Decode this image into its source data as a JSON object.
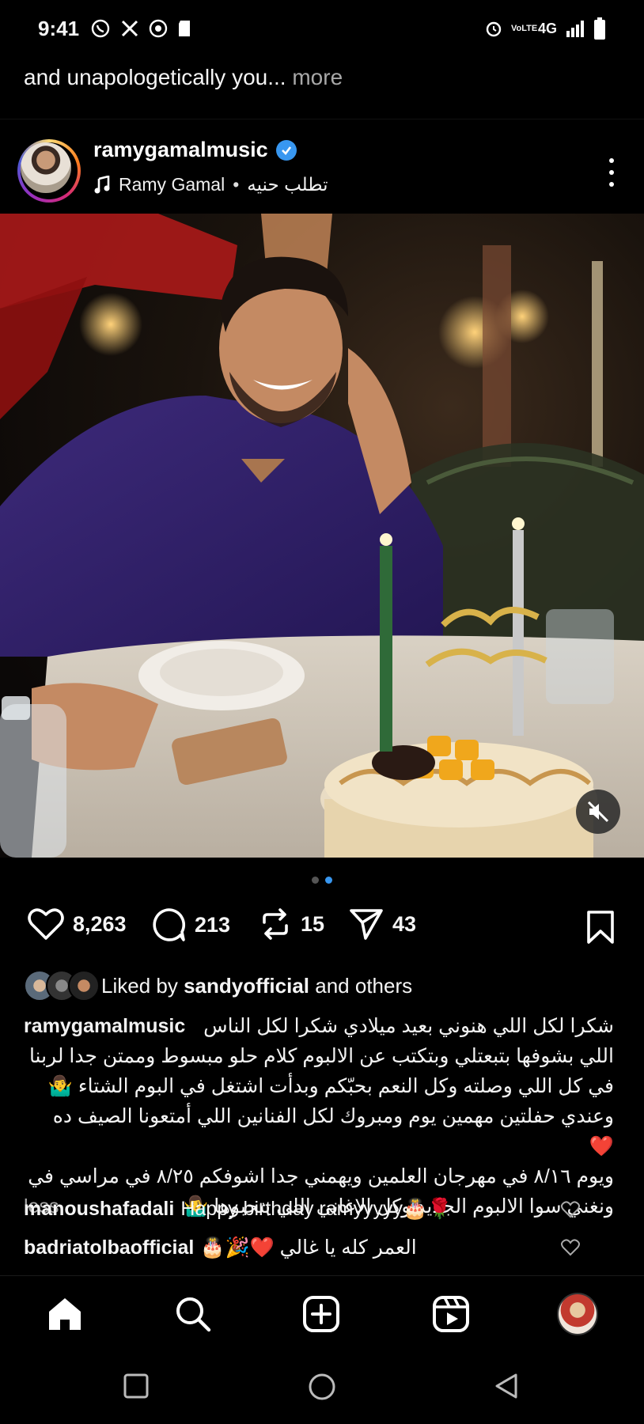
{
  "status_bar": {
    "time": "9:41",
    "left_icons": [
      "whatsapp-icon",
      "x-icon",
      "chrome-icon",
      "sd-card-icon"
    ],
    "network": "4G",
    "volte": "VoLTE"
  },
  "previous_post": {
    "caption_tail": "and unapologetically you...",
    "more_label": "more"
  },
  "post": {
    "username": "ramygamalmusic",
    "verified": true,
    "audio_artist": "Ramy Gamal",
    "audio_separator": "•",
    "audio_track": "تطلب حنيه",
    "carousel": {
      "count": 2,
      "active_index": 1
    },
    "stats": {
      "likes": "8,263",
      "comments": "213",
      "reposts": "15",
      "shares": "43"
    },
    "liked_by_prefix": "Liked by",
    "liked_by_user": "sandyofficial",
    "liked_by_suffix": "and others",
    "caption_user": "ramygamalmusic",
    "caption_lines": [
      "شكرا لكل اللي هنوني بعيد ميلادي شكرا لكل الناس",
      "اللي بشوفها بتبعتلي وبتكتب عن الالبوم كلام حلو مبسوط وممتن جدا لربنا",
      "في كل اللي وصلته وكل النعم بحبّكم وبدأت اشتغل في البوم الشتاء 🤷‍♂️",
      "وعندي حفلتين مهمين يوم ومبروك لكل الفنانين اللي أمتعونا الصيف ده ❤️",
      "ويوم ٨/١٦ في مهرجان العلمين ويهمني جدا اشوفكم ٨/٢٥ في مراسي في",
      "ونغني سوا الالبوم الجديد وكل الاغاني اللي بتحبوها 🤷‍♂️"
    ],
    "less_label": "less",
    "comments": [
      {
        "user": "manoushafadali",
        "text": "Happy birthday ramyyyyy🎂🌹"
      },
      {
        "user": "badriatolbaofficial",
        "text": "العمر كله يا غالي ❤️🎉🎂"
      }
    ]
  },
  "bottom_nav": [
    "home-icon",
    "search-icon",
    "create-icon",
    "reels-icon",
    "profile-avatar"
  ],
  "colors": {
    "background": "#000000",
    "accent": "#3897f0",
    "muted": "#a8a8a8"
  }
}
